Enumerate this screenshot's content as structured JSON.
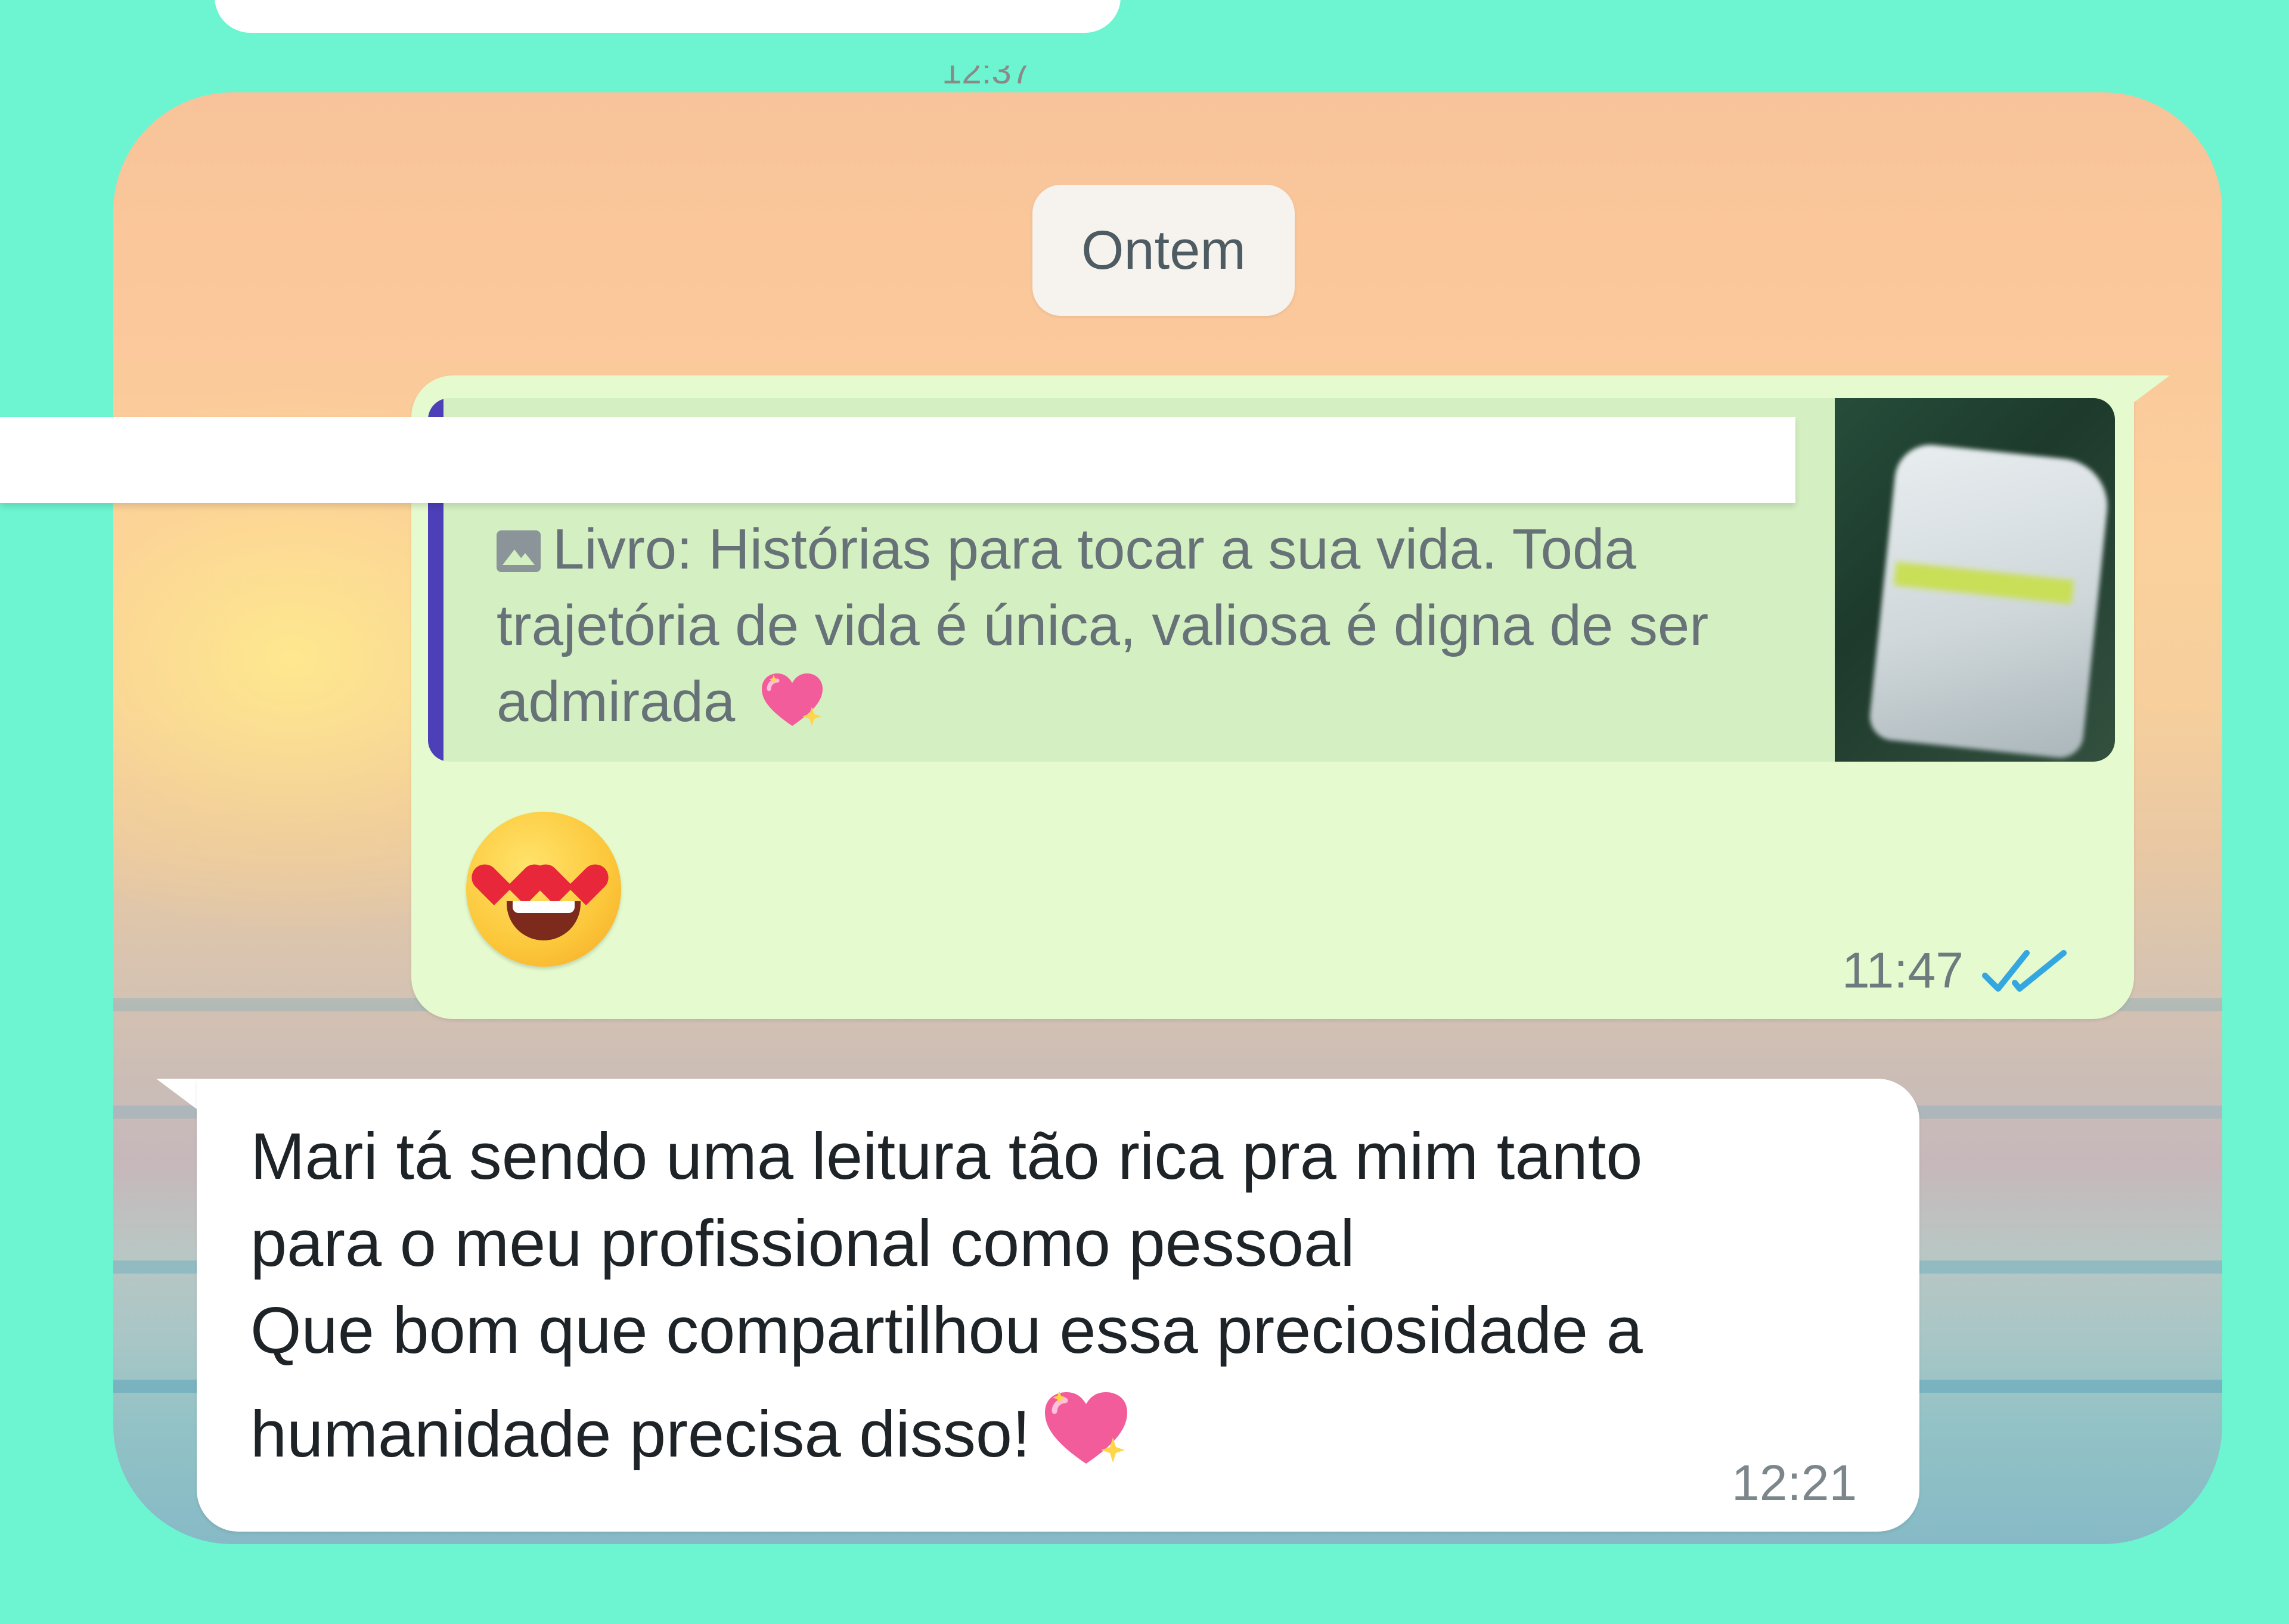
{
  "chat": {
    "top_message_time_partial": "12:37",
    "date_divider": "Ontem",
    "outgoing": {
      "quote_icon": "image-icon",
      "quote_text": "Livro: Histórias para tocar a sua vida. Toda trajetória de vida é única, valiosa é digna de ser admirada",
      "quote_emoji": "sparkling-heart-icon",
      "thumbnail": "book-thumbnail",
      "message_emoji": "heart-eyes-emoji",
      "time": "11:47",
      "status_icon": "double-check-read-icon"
    },
    "incoming": {
      "lines": [
        "Mari tá sendo uma leitura tão rica pra mim tanto",
        "para o meu profissional como pessoal",
        "Que bom que compartilhou essa preciosidade a",
        "humanidade precisa disso!"
      ],
      "emoji": "sparkling-heart-icon",
      "time": "12:21"
    }
  },
  "colors": {
    "page_background": "#6cf5d0",
    "outgoing_bubble": "#e5fbcf",
    "quote_background": "#d4efc1",
    "quote_bar": "#4c3fb8",
    "incoming_bubble": "#ffffff",
    "read_ticks": "#34b7f1"
  }
}
